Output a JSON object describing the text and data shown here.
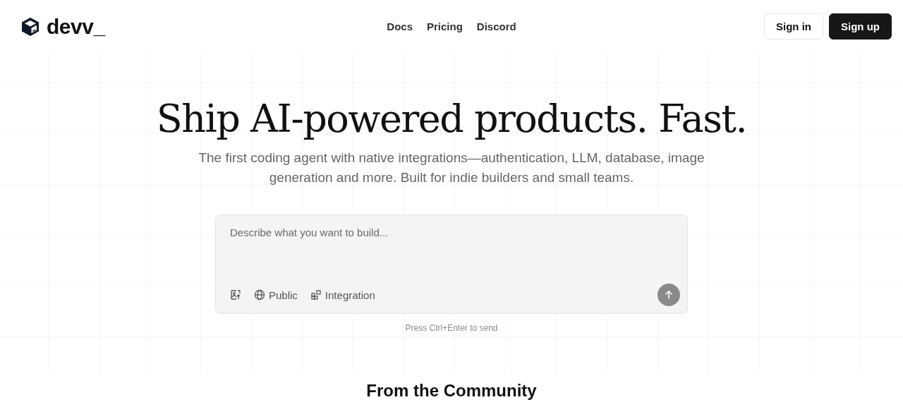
{
  "header": {
    "logo": "devv_",
    "nav": [
      "Docs",
      "Pricing",
      "Discord"
    ],
    "sign_in": "Sign in",
    "sign_up": "Sign up"
  },
  "hero": {
    "title": "Ship AI-powered products. Fast.",
    "subtitle": "The first coding agent with native integrations—authentication, LLM, database, image generation and more. Built for indie builders and small teams."
  },
  "prompt": {
    "placeholder": "Describe what you want to build...",
    "tools": [
      {
        "kind": "image"
      },
      {
        "kind": "visibility",
        "label": "Public"
      },
      {
        "kind": "integration",
        "label": "Integration"
      }
    ],
    "hint": "Press Ctrl+Enter to send"
  },
  "community": {
    "title": "From the Community"
  }
}
